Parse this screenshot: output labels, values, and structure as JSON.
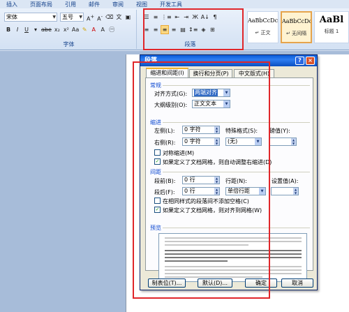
{
  "ribbon": {
    "tabs": [
      "插入",
      "页面布局",
      "引用",
      "邮件",
      "审阅",
      "视图",
      "开发工具"
    ],
    "font": {
      "font_name": "宋体",
      "font_size": "五号",
      "group_label": "字体"
    },
    "paragraph": {
      "group_label": "段落"
    },
    "styles": [
      {
        "sample": "AaBbCcDc",
        "name": "↵ 正文"
      },
      {
        "sample": "AaBbCcDc",
        "name": "↵ 无间隔"
      },
      {
        "sample": "AaBl",
        "name": "标题 1"
      }
    ]
  },
  "dialog": {
    "title": "段落",
    "help_label": "?",
    "close_label": "×",
    "tabs": [
      "缩进和间距(I)",
      "换行和分页(P)",
      "中文版式(H)"
    ],
    "general": {
      "section_label": "常规",
      "alignment_label": "对齐方式(G):",
      "alignment_value": "两端对齐",
      "outline_label": "大纲级别(O):",
      "outline_value": "正文文本"
    },
    "indent": {
      "section_label": "缩进",
      "left_label": "左侧(L):",
      "left_value": "0 字符",
      "right_label": "右侧(R):",
      "right_value": "0 字符",
      "special_label": "特殊格式(S):",
      "special_value": "(无)",
      "by_label": "磅值(Y):",
      "by_value": "",
      "mirror_label": "对称缩进(M)",
      "auto_adjust_label": "如果定义了文档网格，则自动调整右缩进(D)"
    },
    "spacing": {
      "section_label": "间距",
      "before_label": "段前(B):",
      "before_value": "0 行",
      "after_label": "段后(F):",
      "after_value": "0 行",
      "line_label": "行距(N):",
      "line_value": "单倍行距",
      "at_label": "设置值(A):",
      "at_value": "",
      "no_space_label": "在相同样式的段落间不添加空格(C)",
      "snap_grid_label": "如果定义了文档网格，则对齐到网格(W)"
    },
    "preview": {
      "section_label": "预览"
    },
    "buttons": {
      "tabs_label": "制表位(T)...",
      "default_label": "默认(D)...",
      "ok_label": "确定",
      "cancel_label": "取消"
    },
    "checkbox_checked": "✓"
  },
  "icons": {
    "font_grow": "font-grow-icon",
    "font_shrink": "font-shrink-icon",
    "bold": "bold-icon",
    "italic": "italic-icon",
    "underline": "underline-icon",
    "align_left": "align-left-icon",
    "align_center": "align-center-icon",
    "align_right": "align-right-icon",
    "justify": "justify-icon"
  },
  "colors": {
    "annotation_red": "#e0262a",
    "dialog_title_blue": "#0a5bd8",
    "section_blue": "#0a46d0",
    "selected_yellow": "#fbd882"
  }
}
